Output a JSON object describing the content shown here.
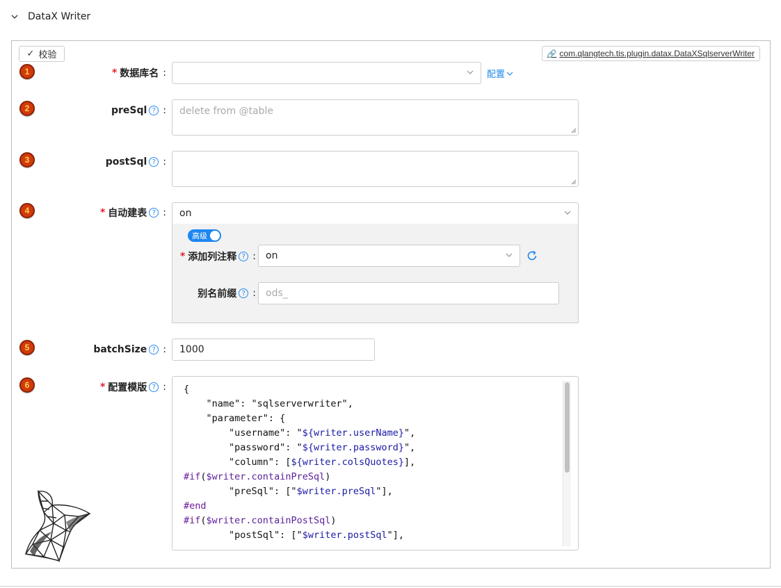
{
  "section": {
    "title": "DataX Writer"
  },
  "toolbar": {
    "validate_label": "校验",
    "plugin_label": "com.qlangtech.tis.plugin.datax.DataXSqlserverWriter"
  },
  "fields": {
    "dbName": {
      "step": "1",
      "label": "数据库名",
      "value": "",
      "config_label": "配置"
    },
    "preSql": {
      "step": "2",
      "label": "preSql",
      "placeholder": "delete from @table"
    },
    "postSql": {
      "step": "3",
      "label": "postSql",
      "value": ""
    },
    "autoCreate": {
      "step": "4",
      "label": "自动建表",
      "value": "on",
      "advanced_label": "高级",
      "addComment": {
        "label": "添加列注释",
        "value": "on"
      },
      "aliasPrefix": {
        "label": "别名前缀",
        "placeholder": "ods_"
      }
    },
    "batchSize": {
      "step": "5",
      "label": "batchSize",
      "value": "1000"
    },
    "template": {
      "step": "6",
      "label": "配置模版"
    }
  },
  "template_lines": [
    "{",
    "    \"name\": \"sqlserverwriter\",",
    "    \"parameter\": {",
    "        \"username\": \"${writer.userName}\",",
    "        \"password\": \"${writer.password}\",",
    "        \"column\": [${writer.colsQuotes}],",
    "#if($writer.containPreSql)",
    "        \"preSql\": [\"$writer.preSql\"],",
    "#end",
    "#if($writer.containPostSql)",
    "        \"postSql\": [\"$writer.postSql\"],"
  ],
  "colors": {
    "accent": "#1e87f0",
    "required": "#e5202e",
    "step_badge": "#d13a0d"
  },
  "icons": [
    "chevron-down-icon",
    "check-icon",
    "link-icon",
    "help-icon",
    "refresh-icon",
    "sqlserver-logo"
  ]
}
